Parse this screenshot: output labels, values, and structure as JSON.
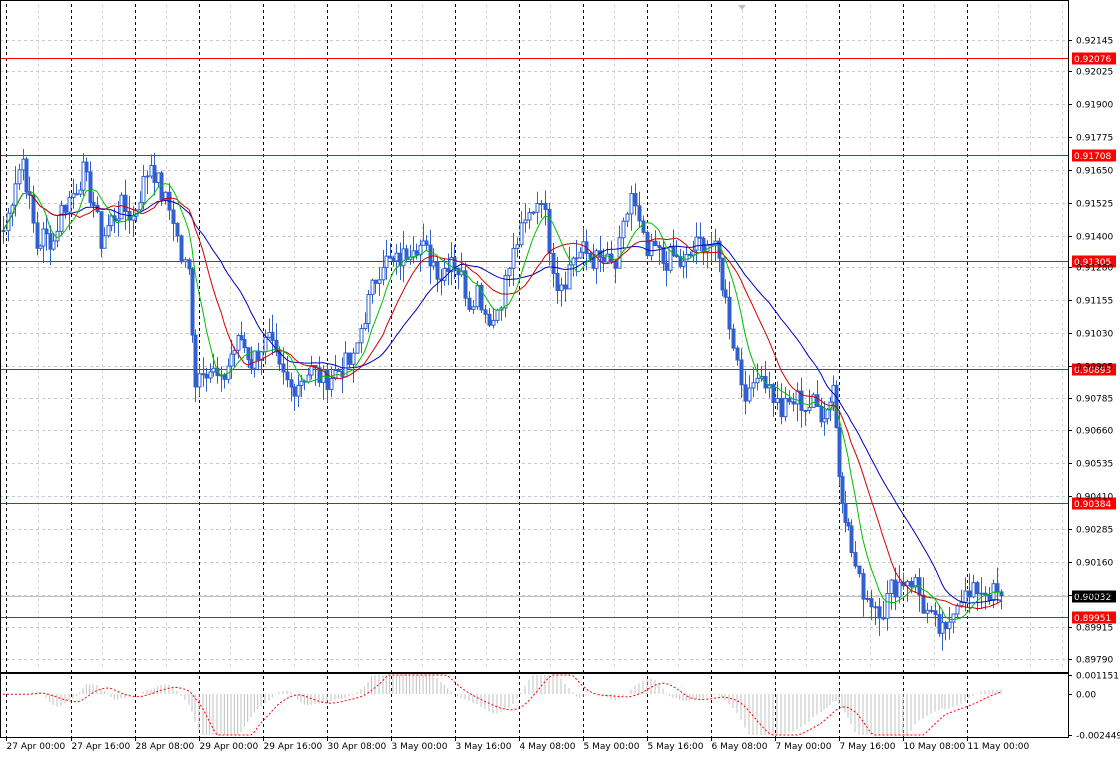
{
  "chart_data": {
    "type": "candlestick",
    "price_axis": {
      "range": [
        0.8975,
        0.9228
      ],
      "ticks": [
        "0.92145",
        "0.92025",
        "0.91900",
        "0.91775",
        "0.91650",
        "0.91525",
        "0.91400",
        "0.91280",
        "0.91155",
        "0.91030",
        "0.90905",
        "0.90785",
        "0.90660",
        "0.90535",
        "0.90410",
        "0.90285",
        "0.90160",
        "0.90035",
        "0.89915",
        "0.89790"
      ],
      "current_price_label": "0.90032"
    },
    "levels": [
      {
        "value": 0.92076,
        "label": "0.92076",
        "color": "#ff0000"
      },
      {
        "value": 0.91708,
        "label": "0.91708",
        "color": "#ff0000"
      },
      {
        "value": 0.91305,
        "label": "0.91305",
        "color": "#ff0000"
      },
      {
        "value": 0.90893,
        "label": "0.90893",
        "color": "#ff0000"
      },
      {
        "value": 0.90384,
        "label": "0.90384",
        "color": "#ff0000"
      },
      {
        "value": 0.89951,
        "label": "0.89951",
        "color": "#ff0000"
      }
    ],
    "time_labels": [
      "27 Apr 00:00",
      "27 Apr 16:00",
      "28 Apr 08:00",
      "29 Apr 00:00",
      "29 Apr 16:00",
      "30 Apr 08:00",
      "3 May 00:00",
      "3 May 16:00",
      "4 May 08:00",
      "5 May 00:00",
      "5 May 16:00",
      "6 May 08:00",
      "7 May 00:00",
      "7 May 16:00",
      "10 May 08:00",
      "11 May 00:00"
    ],
    "close_path": [
      [
        0.9142,
        0
      ],
      [
        0.9148,
        5
      ],
      [
        0.9162,
        12
      ],
      [
        0.9169,
        20
      ],
      [
        0.9152,
        26
      ],
      [
        0.9136,
        34
      ],
      [
        0.914,
        40
      ],
      [
        0.9138,
        50
      ],
      [
        0.915,
        58
      ],
      [
        0.9156,
        70
      ],
      [
        0.9164,
        80
      ],
      [
        0.9152,
        90
      ],
      [
        0.9138,
        98
      ],
      [
        0.9146,
        108
      ],
      [
        0.9151,
        118
      ],
      [
        0.9147,
        130
      ],
      [
        0.916,
        140
      ],
      [
        0.9168,
        148
      ],
      [
        0.9156,
        158
      ],
      [
        0.9147,
        170
      ],
      [
        0.9131,
        178
      ],
      [
        0.9126,
        186
      ],
      [
        0.9085,
        192
      ],
      [
        0.9091,
        200
      ],
      [
        0.9088,
        210
      ],
      [
        0.9083,
        218
      ],
      [
        0.9095,
        228
      ],
      [
        0.9101,
        238
      ],
      [
        0.9092,
        248
      ],
      [
        0.9098,
        258
      ],
      [
        0.91,
        266
      ],
      [
        0.9088,
        276
      ],
      [
        0.9082,
        288
      ],
      [
        0.9086,
        298
      ],
      [
        0.9089,
        308
      ],
      [
        0.9085,
        320
      ],
      [
        0.9088,
        332
      ],
      [
        0.9091,
        342
      ],
      [
        0.9092,
        350
      ],
      [
        0.9105,
        358
      ],
      [
        0.9115,
        365
      ],
      [
        0.9124,
        372
      ],
      [
        0.9131,
        380
      ],
      [
        0.9129,
        390
      ],
      [
        0.9132,
        400
      ],
      [
        0.9138,
        410
      ],
      [
        0.9135,
        420
      ],
      [
        0.913,
        430
      ],
      [
        0.9125,
        438
      ],
      [
        0.9133,
        448
      ],
      [
        0.9124,
        458
      ],
      [
        0.9115,
        466
      ],
      [
        0.912,
        474
      ],
      [
        0.9111,
        482
      ],
      [
        0.9108,
        490
      ],
      [
        0.9117,
        498
      ],
      [
        0.9128,
        506
      ],
      [
        0.9138,
        514
      ],
      [
        0.9144,
        522
      ],
      [
        0.9151,
        530
      ],
      [
        0.9156,
        538
      ],
      [
        0.9137,
        546
      ],
      [
        0.9122,
        554
      ],
      [
        0.9124,
        562
      ],
      [
        0.9132,
        570
      ],
      [
        0.9134,
        580
      ],
      [
        0.9131,
        590
      ],
      [
        0.913,
        600
      ],
      [
        0.9128,
        612
      ],
      [
        0.9142,
        620
      ],
      [
        0.9156,
        628
      ],
      [
        0.9143,
        636
      ],
      [
        0.9132,
        644
      ],
      [
        0.9135,
        652
      ],
      [
        0.913,
        660
      ],
      [
        0.9132,
        670
      ],
      [
        0.9128,
        680
      ],
      [
        0.9135,
        690
      ],
      [
        0.9138,
        700
      ],
      [
        0.9137,
        708
      ],
      [
        0.913,
        716
      ],
      [
        0.9115,
        722
      ],
      [
        0.91,
        730
      ],
      [
        0.9085,
        738
      ],
      [
        0.9078,
        746
      ],
      [
        0.909,
        754
      ],
      [
        0.9085,
        762
      ],
      [
        0.9079,
        770
      ],
      [
        0.9073,
        778
      ],
      [
        0.9076,
        786
      ],
      [
        0.9078,
        794
      ],
      [
        0.9075,
        802
      ],
      [
        0.9076,
        810
      ],
      [
        0.9073,
        818
      ],
      [
        0.9074,
        824
      ],
      [
        0.9084,
        830
      ],
      [
        0.905,
        836
      ],
      [
        0.9035,
        842
      ],
      [
        0.902,
        848
      ],
      [
        0.9008,
        856
      ],
      [
        0.9003,
        864
      ],
      [
        0.9,
        872
      ],
      [
        0.8998,
        880
      ],
      [
        0.9006,
        888
      ],
      [
        0.9008,
        896
      ],
      [
        0.901,
        904
      ],
      [
        0.9008,
        912
      ],
      [
        0.8999,
        920
      ],
      [
        0.8994,
        928
      ],
      [
        0.899,
        936
      ],
      [
        0.8988,
        942
      ],
      [
        0.9,
        950
      ],
      [
        0.9004,
        958
      ],
      [
        0.9002,
        966
      ],
      [
        0.9006,
        974
      ],
      [
        0.9005,
        982
      ],
      [
        0.9004,
        990
      ],
      [
        0.90032,
        998
      ]
    ],
    "indicator": {
      "ticks": [
        "0.001151",
        "0.00",
        "-0.002449"
      ],
      "range": [
        -0.00245,
        0.00115
      ],
      "signal_color": "#ff0000",
      "histogram_color": "#c0c0c0"
    },
    "ma_colors": {
      "fast": "#00c000",
      "mid": "#d00000",
      "slow": "#0000c0"
    },
    "candle_color": "#3060d0",
    "grid": true
  }
}
